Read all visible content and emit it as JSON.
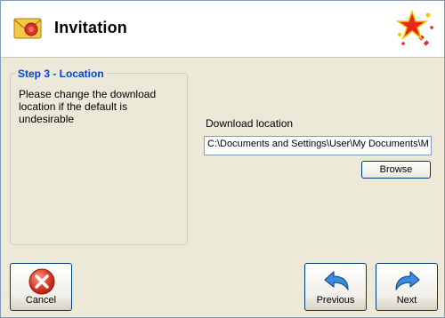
{
  "header": {
    "title": "Invitation",
    "icon": "envelope-seal-icon",
    "logo": "magic-star-wand-icon"
  },
  "step": {
    "title": "Step 3 - Location",
    "description": "Please change the download location if the default is undesirable"
  },
  "download": {
    "label": "Download location",
    "value": "C:\\Documents and Settings\\User\\My Documents\\M"
  },
  "buttons": {
    "browse": "Browse",
    "cancel": "Cancel",
    "previous": "Previous",
    "next": "Next"
  },
  "colors": {
    "window_bg": "#ece9d8",
    "header_bg": "#ffffff",
    "step_title": "#0046d5",
    "cancel_red": "#d83a2a",
    "arrow_blue": "#2e7bc9"
  }
}
